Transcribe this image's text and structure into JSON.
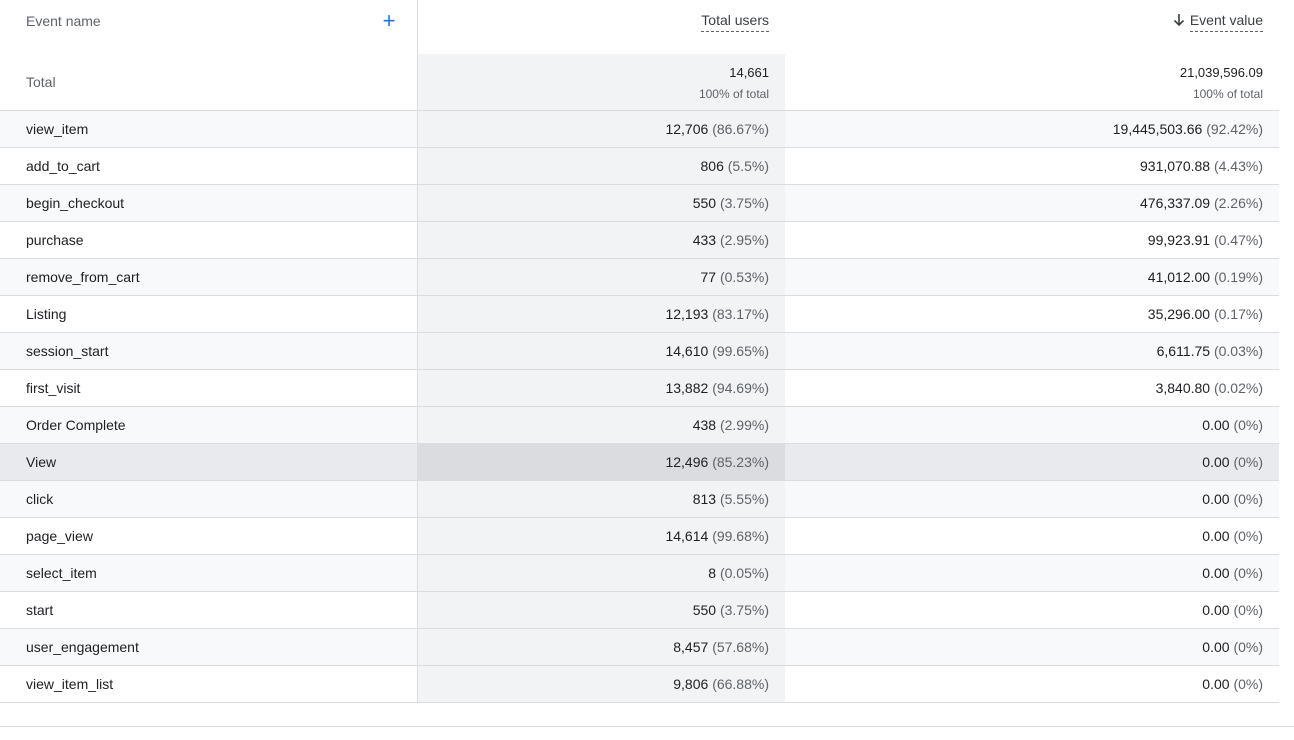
{
  "header": {
    "event_name": "Event name",
    "add_icon": "plus-icon",
    "total_users": "Total users",
    "event_value": "Event value",
    "sort_icon": "arrow-down-icon"
  },
  "total": {
    "label": "Total",
    "users": "14,661",
    "users_pct": "100% of total",
    "value": "21,039,596.09",
    "value_pct": "100% of total"
  },
  "rows": [
    {
      "name": "view_item",
      "users": "12,706",
      "users_pct": "(86.67%)",
      "value": "19,445,503.66",
      "value_pct": "(92.42%)"
    },
    {
      "name": "add_to_cart",
      "users": "806",
      "users_pct": "(5.5%)",
      "value": "931,070.88",
      "value_pct": "(4.43%)"
    },
    {
      "name": "begin_checkout",
      "users": "550",
      "users_pct": "(3.75%)",
      "value": "476,337.09",
      "value_pct": "(2.26%)"
    },
    {
      "name": "purchase",
      "users": "433",
      "users_pct": "(2.95%)",
      "value": "99,923.91",
      "value_pct": "(0.47%)"
    },
    {
      "name": "remove_from_cart",
      "users": "77",
      "users_pct": "(0.53%)",
      "value": "41,012.00",
      "value_pct": "(0.19%)"
    },
    {
      "name": "Listing",
      "users": "12,193",
      "users_pct": "(83.17%)",
      "value": "35,296.00",
      "value_pct": "(0.17%)"
    },
    {
      "name": "session_start",
      "users": "14,610",
      "users_pct": "(99.65%)",
      "value": "6,611.75",
      "value_pct": "(0.03%)"
    },
    {
      "name": "first_visit",
      "users": "13,882",
      "users_pct": "(94.69%)",
      "value": "3,840.80",
      "value_pct": "(0.02%)"
    },
    {
      "name": "Order Complete",
      "users": "438",
      "users_pct": "(2.99%)",
      "value": "0.00",
      "value_pct": "(0%)"
    },
    {
      "name": "View",
      "users": "12,496",
      "users_pct": "(85.23%)",
      "value": "0.00",
      "value_pct": "(0%)"
    },
    {
      "name": "click",
      "users": "813",
      "users_pct": "(5.55%)",
      "value": "0.00",
      "value_pct": "(0%)"
    },
    {
      "name": "page_view",
      "users": "14,614",
      "users_pct": "(99.68%)",
      "value": "0.00",
      "value_pct": "(0%)"
    },
    {
      "name": "select_item",
      "users": "8",
      "users_pct": "(0.05%)",
      "value": "0.00",
      "value_pct": "(0%)"
    },
    {
      "name": "start",
      "users": "550",
      "users_pct": "(3.75%)",
      "value": "0.00",
      "value_pct": "(0%)"
    },
    {
      "name": "user_engagement",
      "users": "8,457",
      "users_pct": "(57.68%)",
      "value": "0.00",
      "value_pct": "(0%)"
    },
    {
      "name": "view_item_list",
      "users": "9,806",
      "users_pct": "(66.88%)",
      "value": "0.00",
      "value_pct": "(0%)"
    }
  ],
  "colors": {
    "accent": "#1a73e8",
    "border": "#dadce0",
    "shade": "#f1f3f4",
    "row_alt": "#f8f9fa",
    "row_highlight": "#e8eaed"
  }
}
